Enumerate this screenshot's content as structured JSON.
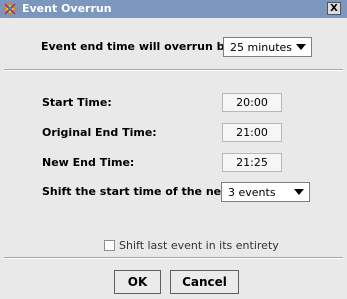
{
  "window": {
    "title": "Event Overrun",
    "close_glyph": "X",
    "icon": "sparkle-icon"
  },
  "overrun": {
    "label": "Event end time will overrun by:",
    "selected": "25  minutes"
  },
  "times": {
    "start_label": "Start Time:",
    "start_value": "20:00",
    "original_end_label": "Original End Time:",
    "original_end_value": "21:00",
    "new_end_label": "New End Time:",
    "new_end_value": "21:25"
  },
  "shift": {
    "label": "Shift the start time of the next",
    "selected": "3  events"
  },
  "shift_last": {
    "label": "Shift last event in its entirety",
    "checked": false
  },
  "buttons": {
    "ok": "OK",
    "cancel": "Cancel"
  }
}
